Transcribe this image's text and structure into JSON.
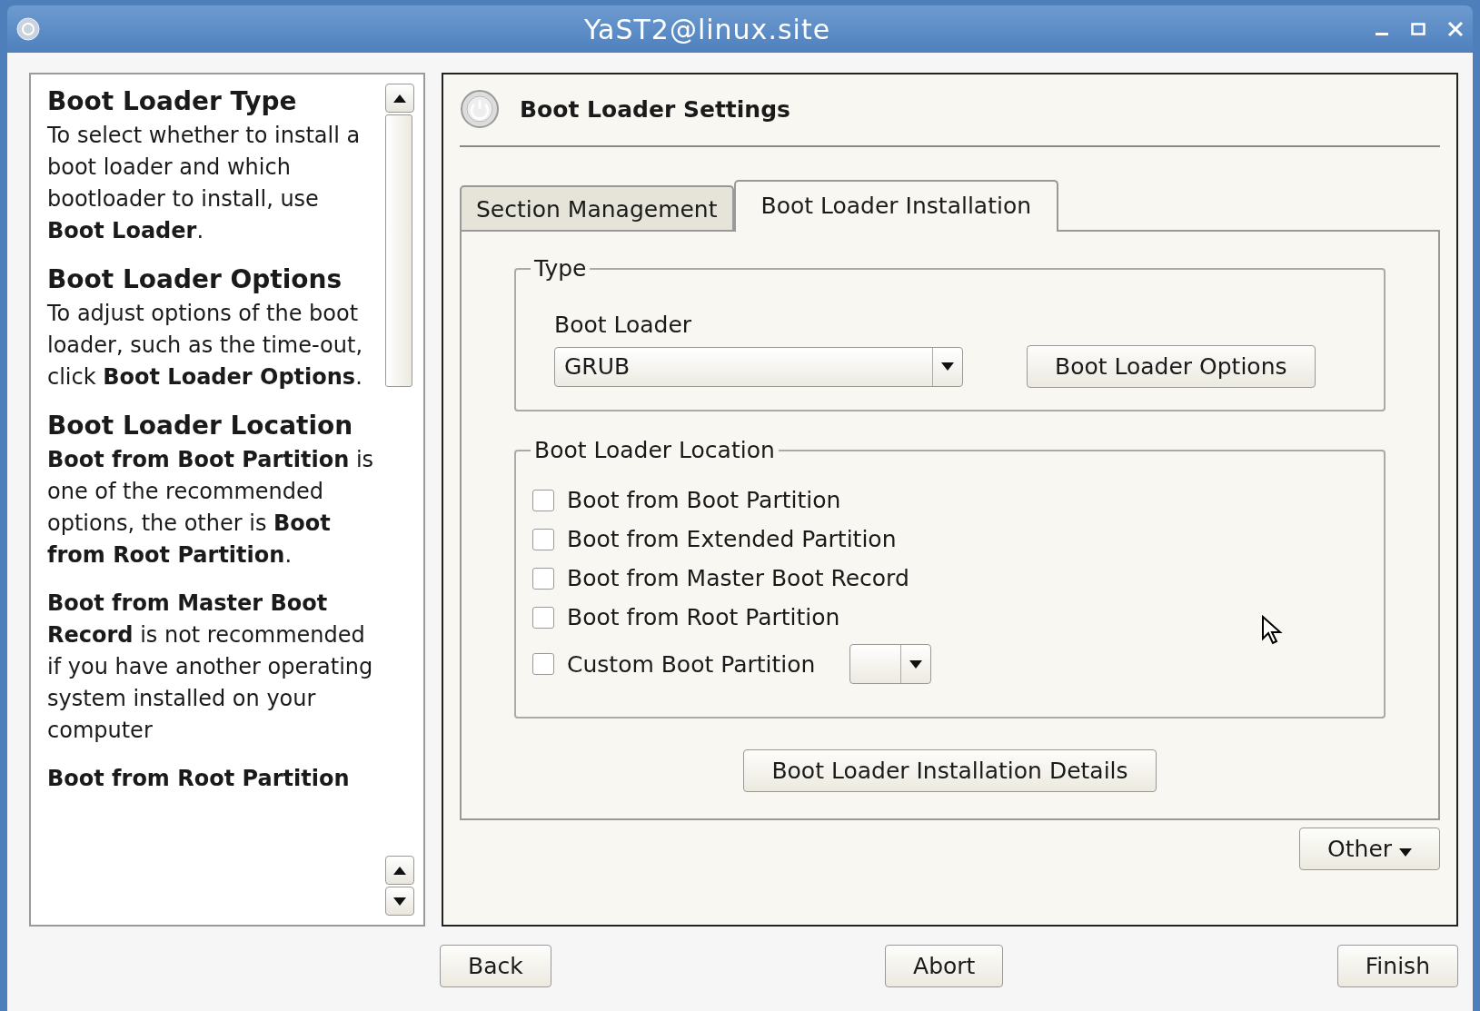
{
  "window": {
    "title": "YaST2@linux.site"
  },
  "help": [
    {
      "heading": "Boot Loader Type",
      "paragraphs": [
        "To select whether to install a boot loader and which bootloader to install, use **Boot Loader**."
      ]
    },
    {
      "heading": "Boot Loader Options",
      "paragraphs": [
        "To adjust options of the boot loader, such as the time-out, click **Boot Loader Options**."
      ]
    },
    {
      "heading": "Boot Loader Location",
      "paragraphs": [
        "**Boot from Boot Partition** is one of the recommended options, the other is **Boot from Root Partition**.",
        "**Boot from Master Boot Record** is not recommended if you have another operating system installed on your computer",
        "**Boot from Root Partition**"
      ]
    }
  ],
  "header": {
    "title": "Boot Loader Settings"
  },
  "tabs": [
    {
      "label": "Section Management",
      "selected": false
    },
    {
      "label": "Boot Loader Installation",
      "selected": true
    }
  ],
  "type_group": {
    "legend": "Type",
    "field_label": {
      "text": "Boot Loader"
    },
    "value": "GRUB",
    "button": {
      "text": "Boot Loader Options"
    }
  },
  "location_group": {
    "legend": "Boot Loader Location",
    "options": [
      {
        "label": "Boot from Boot Partition",
        "checked": false
      },
      {
        "label": "Boot from Extended Partition",
        "checked": false
      },
      {
        "label": "Boot from Master Boot Record",
        "checked": false
      },
      {
        "label": "Boot from Root Partition",
        "checked": false
      },
      {
        "label": "Custom Boot Partition",
        "checked": false,
        "kind": "combo"
      }
    ]
  },
  "details_button": {
    "text": "Boot Loader Installation Details"
  },
  "other_button": {
    "text": "Other"
  },
  "footer": [
    {
      "text": "Back"
    },
    {
      "text": "Abort"
    },
    {
      "text": "Finish"
    }
  ]
}
